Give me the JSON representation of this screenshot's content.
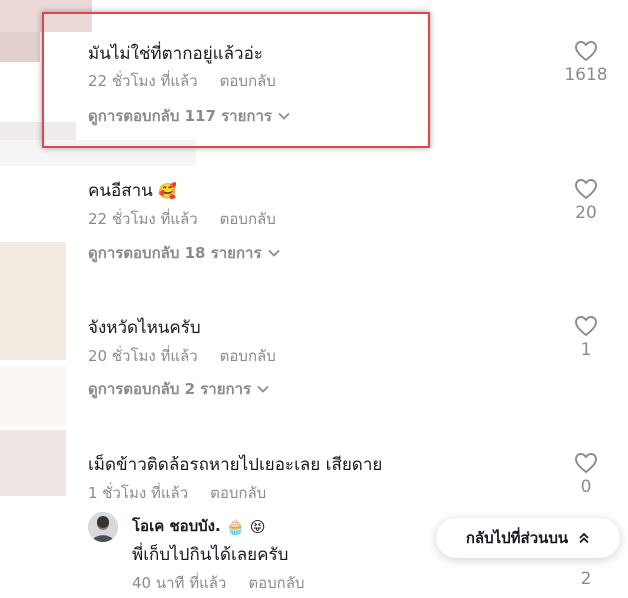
{
  "comments": [
    {
      "text": "มันไม่ใช่ที่ตากอยู่แล้วอ่ะ",
      "time": "22 ชั่วโมง ที่แล้ว",
      "reply_label": "ตอบกลับ",
      "view_replies": "ดูการตอบกลับ 117 รายการ",
      "likes": "1618"
    },
    {
      "text": "คนอีสาน",
      "emoji": "🥰",
      "time": "22 ชั่วโมง ที่แล้ว",
      "reply_label": "ตอบกลับ",
      "view_replies": "ดูการตอบกลับ 18 รายการ",
      "likes": "20"
    },
    {
      "text": "จังหวัดไหนครับ",
      "time": "20 ชั่วโมง ที่แล้ว",
      "reply_label": "ตอบกลับ",
      "view_replies": "ดูการตอบกลับ 2 รายการ",
      "likes": "1"
    },
    {
      "text": "เม็ดข้าวติดล้อรถหายไปเยอะเลย เสียดาย",
      "time": "1 ชั่วโมง ที่แล้ว",
      "reply_label": "ตอบกลับ",
      "likes": "0"
    }
  ],
  "reply": {
    "author": "โอเค ชอบบัง.",
    "author_emojis": "🧁 😝",
    "text": "พี่เก็บไปกินได้เลยครับ",
    "time": "40 นาที ที่แล้ว",
    "reply_label": "ตอบกลับ",
    "likes": "2"
  },
  "back_to_top": "กลับไปที่ส่วนบน",
  "colors": {
    "highlight_border": "#e0474c",
    "muted_text": "#8a8b91",
    "primary_text": "#161823"
  }
}
